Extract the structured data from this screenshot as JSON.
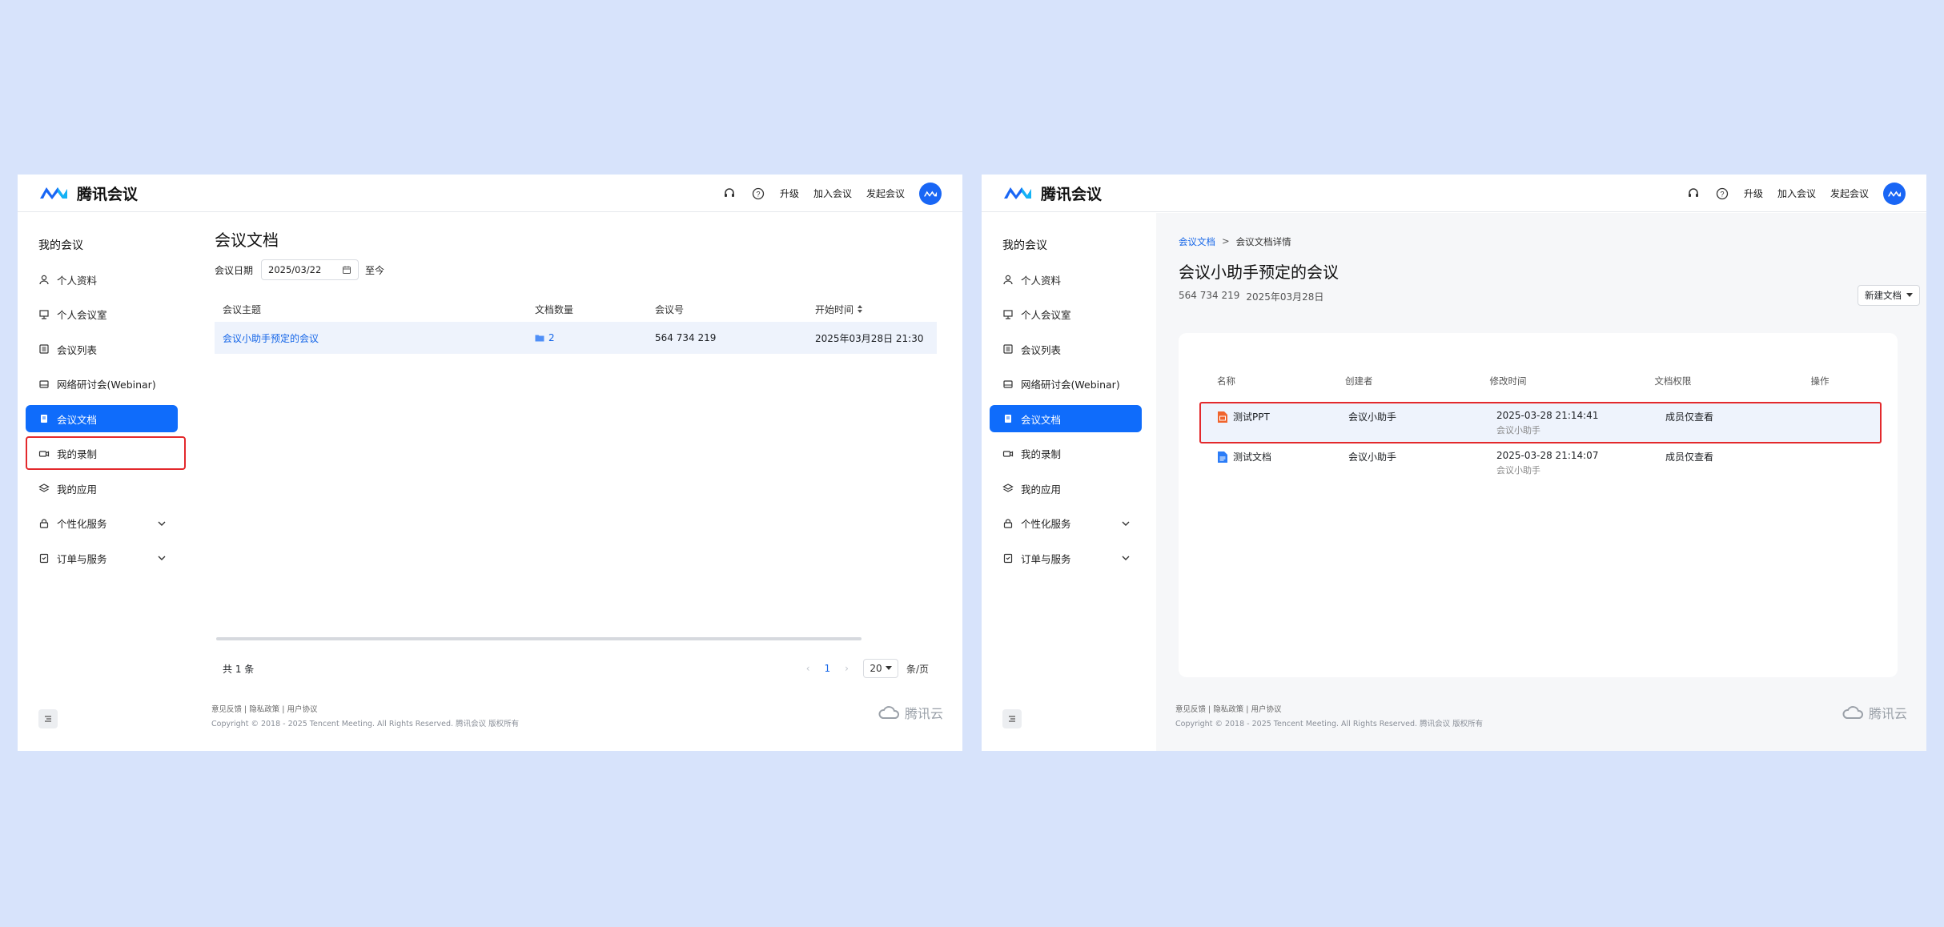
{
  "app": {
    "logo_text": "腾讯会议",
    "top_nav": {
      "upgrade": "升级",
      "join": "加入会议",
      "start": "发起会议"
    }
  },
  "sidebar": {
    "title": "我的会议",
    "items": [
      {
        "label": "个人资料",
        "icon": "user-icon"
      },
      {
        "label": "个人会议室",
        "icon": "room-icon"
      },
      {
        "label": "会议列表",
        "icon": "list-icon"
      },
      {
        "label": "网络研讨会(Webinar)",
        "icon": "webinar-icon"
      },
      {
        "label": "会议文档",
        "icon": "document-icon",
        "active": true
      },
      {
        "label": "我的录制",
        "icon": "video-icon"
      },
      {
        "label": "我的应用",
        "icon": "layers-icon"
      },
      {
        "label": "个性化服务",
        "icon": "lock-icon",
        "expandable": true
      },
      {
        "label": "订单与服务",
        "icon": "clipboard-icon",
        "expandable": true
      }
    ]
  },
  "left_page": {
    "title": "会议文档",
    "filter": {
      "label": "会议日期",
      "date": "2025/03/22",
      "to": "至今"
    },
    "table": {
      "headers": [
        "会议主题",
        "文档数量",
        "会议号",
        "开始时间"
      ],
      "rows": [
        {
          "topic": "会议小助手预定的会议",
          "doc_count": "2",
          "meeting_id": "564 734 219",
          "start_time": "2025年03月28日 21:30"
        }
      ]
    },
    "pager": {
      "total": "共 1 条",
      "current": "1",
      "page_size": "20",
      "unit": "条/页"
    }
  },
  "right_page": {
    "breadcrumb": {
      "root": "会议文档",
      "sep": ">",
      "current": "会议文档详情"
    },
    "title": "会议小助手预定的会议",
    "meeting_id": "564 734 219",
    "date": "2025年03月28日",
    "new_doc_label": "新建文档",
    "table": {
      "headers": [
        "名称",
        "创建者",
        "修改时间",
        "文档权限",
        "操作"
      ],
      "rows": [
        {
          "name": "测试PPT",
          "type": "ppt",
          "creator": "会议小助手",
          "modified": "2025-03-28 21:14:41",
          "modifier": "会议小助手",
          "permission": "成员仅查看"
        },
        {
          "name": "测试文档",
          "type": "doc",
          "creator": "会议小助手",
          "modified": "2025-03-28 21:14:07",
          "modifier": "会议小助手",
          "permission": "成员仅查看"
        }
      ]
    }
  },
  "footer": {
    "links": "意见反馈 | 隐私政策 | 用户协议",
    "copyright": "Copyright © 2018 - 2025 Tencent Meeting. All Rights Reserved. 腾讯会议 版权所有",
    "cloud_logo": "腾讯云"
  },
  "colors": {
    "primary": "#0f6cfb",
    "highlight": "#e3292c",
    "ppt": "#f0642c",
    "doc": "#2b7cf7"
  }
}
